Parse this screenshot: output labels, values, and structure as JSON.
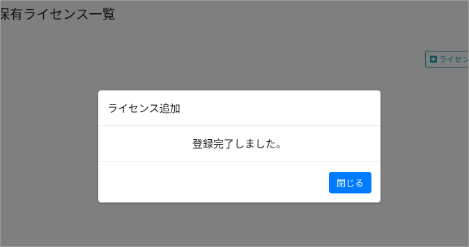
{
  "page": {
    "title": "保有ライセンス一覧",
    "add_button_label": "ライセン"
  },
  "modal": {
    "title": "ライセンス追加",
    "message": "登録完了しました。",
    "close_label": "閉じる"
  },
  "colors": {
    "primary": "#007bff",
    "info": "#17a2b8",
    "backdrop": "rgba(0,0,0,0.5)"
  }
}
